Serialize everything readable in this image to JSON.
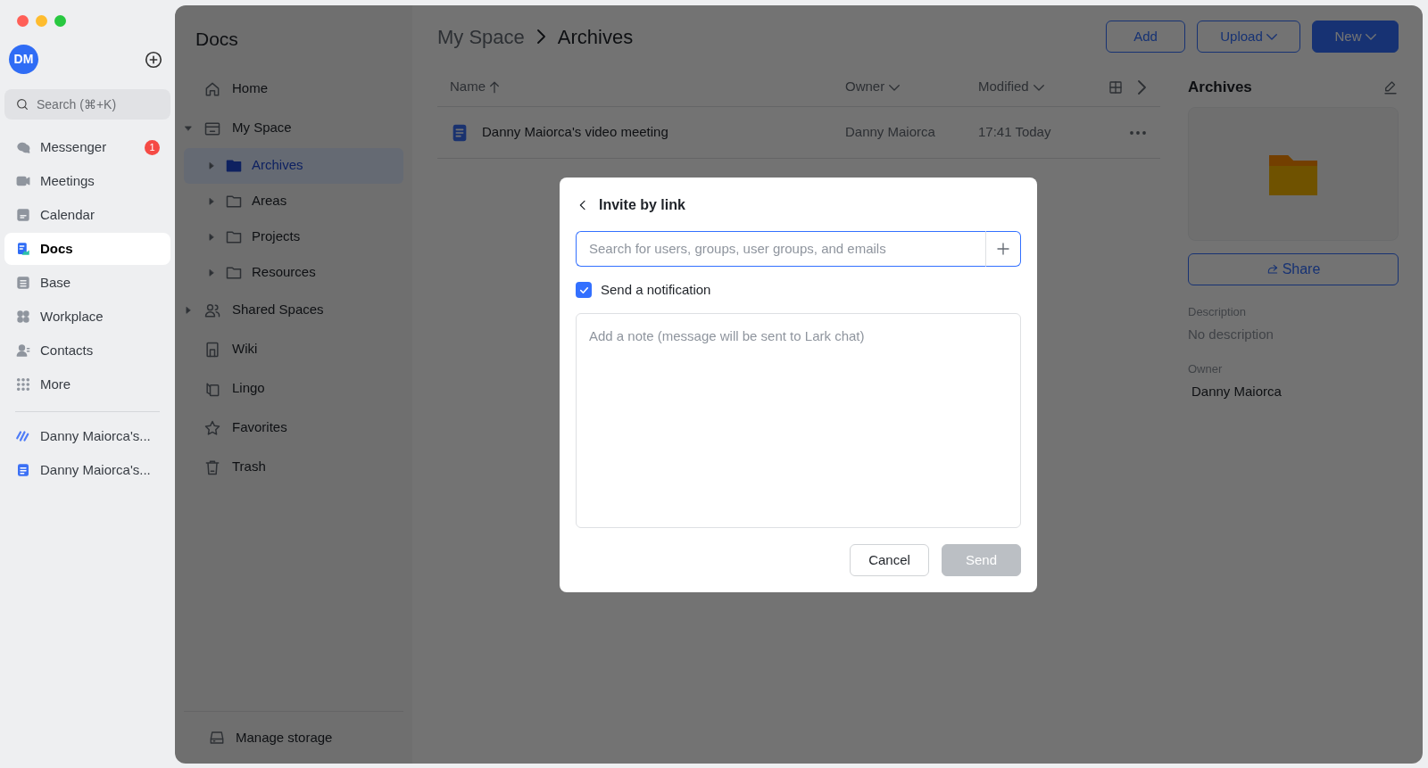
{
  "app_sidebar": {
    "avatar": "DM",
    "search_placeholder": "Search (⌘+K)",
    "items": [
      {
        "label": "Messenger",
        "selected": false,
        "badge": "1"
      },
      {
        "label": "Meetings",
        "selected": false
      },
      {
        "label": "Calendar",
        "selected": false
      },
      {
        "label": "Docs",
        "selected": true
      },
      {
        "label": "Base",
        "selected": false
      },
      {
        "label": "Workplace",
        "selected": false
      },
      {
        "label": "Contacts",
        "selected": false
      },
      {
        "label": "More",
        "selected": false
      }
    ],
    "recent": [
      {
        "label": "Danny Maiorca's...",
        "kind": "whiteboard"
      },
      {
        "label": "Danny Maiorca's...",
        "kind": "doc"
      }
    ]
  },
  "docs_nav": {
    "title": "Docs",
    "items": [
      {
        "label": "Home",
        "selected": false
      },
      {
        "label": "My Space",
        "selected": false,
        "expanded": true,
        "children": [
          {
            "label": "Archives",
            "selected": true,
            "expanded": false
          },
          {
            "label": "Areas",
            "selected": false,
            "expanded": false
          },
          {
            "label": "Projects",
            "selected": false,
            "expanded": false
          },
          {
            "label": "Resources",
            "selected": false,
            "expanded": false
          }
        ]
      },
      {
        "label": "Shared Spaces",
        "selected": false,
        "expanded": false
      },
      {
        "label": "Wiki",
        "selected": false
      },
      {
        "label": "Lingo",
        "selected": false
      },
      {
        "label": "Favorites",
        "selected": false
      },
      {
        "label": "Trash",
        "selected": false
      }
    ],
    "footer": "Manage storage"
  },
  "breadcrumb": [
    "My Space",
    "Archives"
  ],
  "toolbar_buttons": [
    {
      "label": "Add",
      "kind": "outline",
      "menu": false
    },
    {
      "label": "Upload",
      "kind": "outline",
      "menu": true
    },
    {
      "label": "New",
      "kind": "primary",
      "menu": true
    }
  ],
  "table": {
    "columns": [
      {
        "label": "Name",
        "sorted_ascending": true,
        "menu": false
      },
      {
        "label": "Owner",
        "sorted_ascending": false,
        "menu": true
      },
      {
        "label": "Modified",
        "sorted_ascending": false,
        "menu": true
      }
    ],
    "rows": [
      {
        "name": "Danny Maiorca's video meeting",
        "owner": "Danny Maiorca",
        "modified": "17:41 Today"
      }
    ]
  },
  "details": {
    "title": "Archives",
    "share": "Share",
    "fields": [
      {
        "label": "Description",
        "value": "No description",
        "muted": true
      },
      {
        "label": "Owner",
        "value": "Danny Maiorca",
        "muted": false
      }
    ]
  },
  "dialog": {
    "title": "Invite by link",
    "search_placeholder": "Search for users, groups, user groups, and emails",
    "notify": {
      "label": "Send a notification",
      "checked": true
    },
    "note_placeholder": "Add a note (message will be sent to Lark chat)",
    "buttons": [
      {
        "label": "Cancel",
        "disabled": false
      },
      {
        "label": "Send",
        "disabled": true
      }
    ]
  }
}
